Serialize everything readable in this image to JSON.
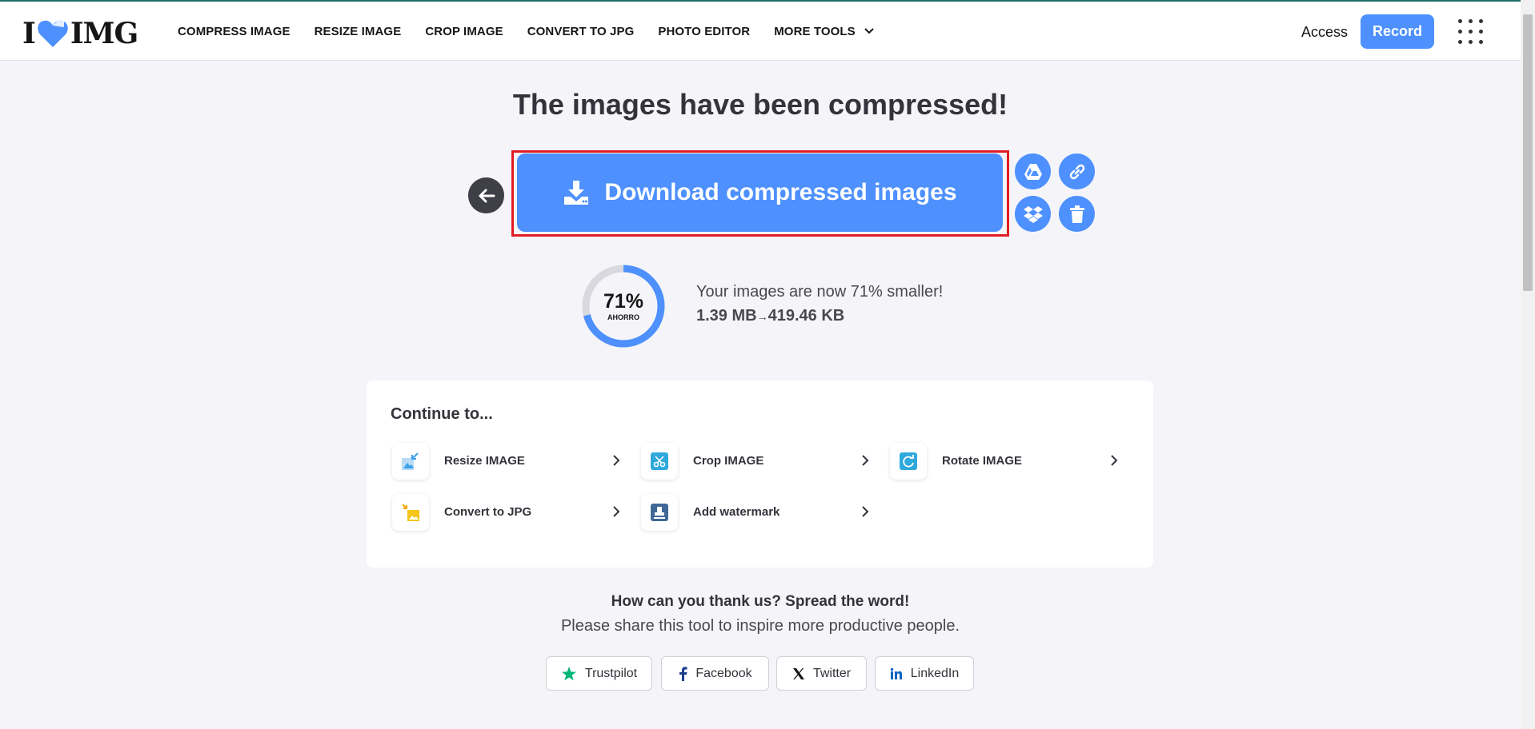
{
  "header": {
    "logo_left": "I",
    "logo_right": "IMG",
    "nav": [
      {
        "label": "COMPRESS IMAGE"
      },
      {
        "label": "RESIZE IMAGE"
      },
      {
        "label": "CROP IMAGE"
      },
      {
        "label": "CONVERT TO JPG"
      },
      {
        "label": "PHOTO EDITOR"
      },
      {
        "label": "MORE TOOLS"
      }
    ],
    "access_label": "Access",
    "record_label": "Record"
  },
  "main": {
    "title": "The images have been compressed!",
    "download_label": "Download compressed images",
    "savings_percent": "71%",
    "savings_fraction": 0.71,
    "savings_sub": "AHORRO",
    "result_text": "Your images are now 71% smaller!",
    "size_before": "1.39 MB",
    "size_after": "419.46 KB",
    "arrow": "→"
  },
  "continue": {
    "title": "Continue to...",
    "tools": [
      {
        "label": "Resize IMAGE",
        "icon": "resize-icon"
      },
      {
        "label": "Crop IMAGE",
        "icon": "crop-icon"
      },
      {
        "label": "Rotate IMAGE",
        "icon": "rotate-icon"
      },
      {
        "label": "Convert to JPG",
        "icon": "convert-jpg-icon"
      },
      {
        "label": "Add watermark",
        "icon": "watermark-icon"
      }
    ]
  },
  "share": {
    "title": "How can you thank us? Spread the word!",
    "subtitle": "Please share this tool to inspire more productive people.",
    "buttons": [
      {
        "label": "Trustpilot"
      },
      {
        "label": "Facebook"
      },
      {
        "label": "Twitter"
      },
      {
        "label": "LinkedIn"
      }
    ]
  },
  "colors": {
    "accent": "#4d90fe",
    "highlight": "#e21b23",
    "dark": "#33333b",
    "trustpilot": "#00b67a",
    "linkedin": "#0a66c2"
  }
}
